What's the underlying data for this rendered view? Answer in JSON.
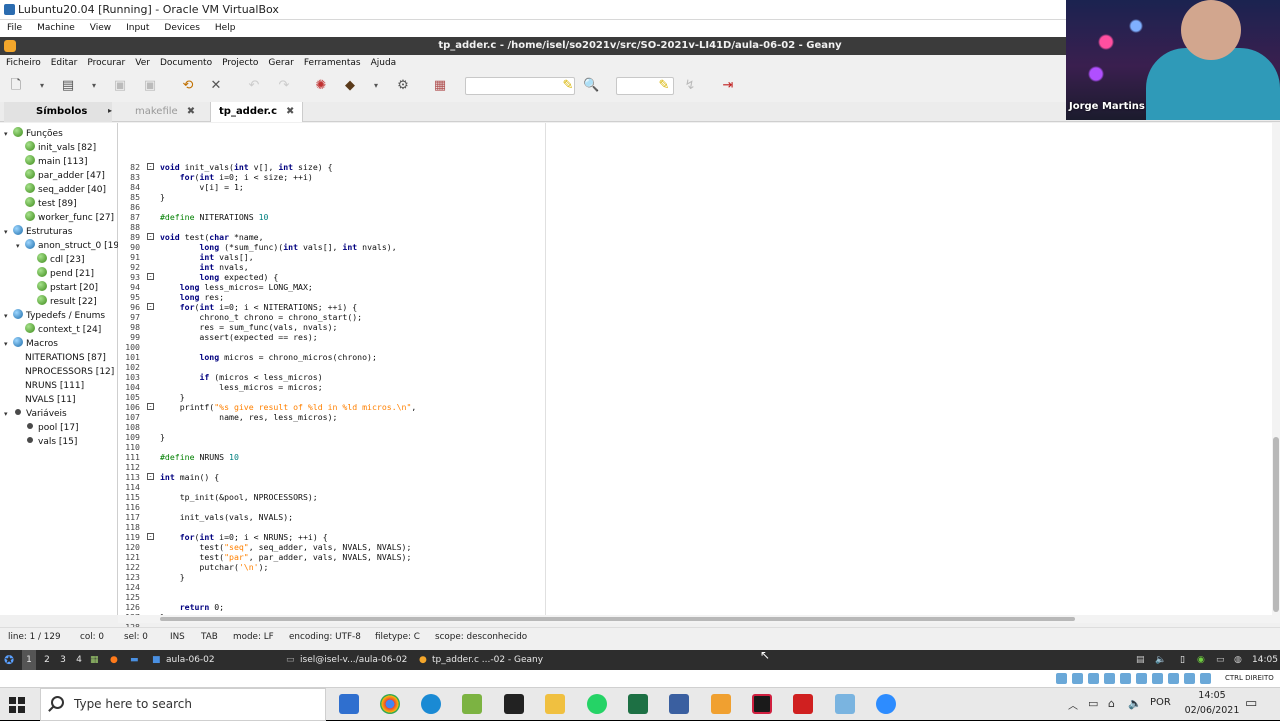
{
  "vbox": {
    "title": "Lubuntu20.04 [Running] - Oracle VM VirtualBox",
    "menu": [
      "File",
      "Machine",
      "View",
      "Input",
      "Devices",
      "Help"
    ]
  },
  "geany": {
    "title": "tp_adder.c - /home/isel/so2021v/src/SO-2021v-LI41D/aula-06-02 - Geany",
    "menu": [
      "Ficheiro",
      "Editar",
      "Procurar",
      "Ver",
      "Documento",
      "Projecto",
      "Gerar",
      "Ferramentas",
      "Ajuda"
    ],
    "sidebar_tab": "Símbolos",
    "tabs": [
      {
        "label": "makefile",
        "active": false
      },
      {
        "label": "tp_adder.c",
        "active": true
      }
    ],
    "symbols": [
      {
        "label": "Funções",
        "level": 0,
        "icon": "function",
        "expander": "open"
      },
      {
        "label": "init_vals [82]",
        "level": 1,
        "icon": "function"
      },
      {
        "label": "main [113]",
        "level": 1,
        "icon": "function"
      },
      {
        "label": "par_adder [47]",
        "level": 1,
        "icon": "function"
      },
      {
        "label": "seq_adder [40]",
        "level": 1,
        "icon": "function"
      },
      {
        "label": "test [89]",
        "level": 1,
        "icon": "function"
      },
      {
        "label": "worker_func [27]",
        "level": 1,
        "icon": "function"
      },
      {
        "label": "Estruturas",
        "level": 0,
        "icon": "struct",
        "expander": "open"
      },
      {
        "label": "anon_struct_0 [19]",
        "level": 1,
        "icon": "struct",
        "expander": "open"
      },
      {
        "label": "cdl [23]",
        "level": 2,
        "icon": "function"
      },
      {
        "label": "pend [21]",
        "level": 2,
        "icon": "function"
      },
      {
        "label": "pstart [20]",
        "level": 2,
        "icon": "function"
      },
      {
        "label": "result [22]",
        "level": 2,
        "icon": "function"
      },
      {
        "label": "Typedefs / Enums",
        "level": 0,
        "icon": "struct",
        "expander": "open"
      },
      {
        "label": "context_t [24]",
        "level": 1,
        "icon": "function"
      },
      {
        "label": "Macros",
        "level": 0,
        "icon": "struct",
        "expander": "open"
      },
      {
        "label": "NITERATIONS [87]",
        "level": 1,
        "icon": "macro"
      },
      {
        "label": "NPROCESSORS [12]",
        "level": 1,
        "icon": "macro"
      },
      {
        "label": "NRUNS [111]",
        "level": 1,
        "icon": "macro"
      },
      {
        "label": "NVALS [11]",
        "level": 1,
        "icon": "macro"
      },
      {
        "label": "Variáveis",
        "level": 0,
        "icon": "var",
        "expander": "open"
      },
      {
        "label": "pool [17]",
        "level": 1,
        "icon": "var"
      },
      {
        "label": "vals [15]",
        "level": 1,
        "icon": "var"
      }
    ],
    "line_numbers": [
      "82",
      "83",
      "84",
      "85",
      "86",
      "87",
      "88",
      "89",
      "90",
      "91",
      "92",
      "93",
      "94",
      "95",
      "96",
      "97",
      "98",
      "99",
      "100",
      "101",
      "102",
      "103",
      "104",
      "105",
      "106",
      "107",
      "108",
      "109",
      "110",
      "111",
      "112",
      "113",
      "114",
      "115",
      "116",
      "117",
      "118",
      "119",
      "120",
      "121",
      "122",
      "123",
      "124",
      "125",
      "126",
      "127",
      "128",
      "129"
    ],
    "code": [
      "void init_vals(int v[], int size) {",
      "    for(int i=0; i < size; ++i)",
      "        v[i] = 1;",
      "}",
      "",
      "#define NITERATIONS 10",
      "",
      "void test(char *name,",
      "        long (*sum_func)(int vals[], int nvals),",
      "        int vals[],",
      "        int nvals,",
      "        long expected) {",
      "    long less_micros= LONG_MAX;",
      "    long res;",
      "    for(int i=0; i < NITERATIONS; ++i) {",
      "        chrono_t chrono = chrono_start();",
      "        res = sum_func(vals, nvals);",
      "        assert(expected == res);",
      "",
      "        long micros = chrono_micros(chrono);",
      "",
      "        if (micros < less_micros)",
      "            less_micros = micros;",
      "    }",
      "    printf(\"%s give result of %ld in %ld micros.\\n\",",
      "            name, res, less_micros);",
      "",
      "}",
      "",
      "#define NRUNS 10",
      "",
      "int main() {",
      "",
      "    tp_init(&pool, NPROCESSORS);",
      "",
      "    init_vals(vals, NVALS);",
      "",
      "    for(int i=0; i < NRUNS; ++i) {",
      "        test(\"seq\", seq_adder, vals, NVALS, NVALS);",
      "        test(\"par\", par_adder, vals, NVALS, NVALS);",
      "        putchar('\\n');",
      "    }",
      "",
      "",
      "    return 0;",
      "}",
      "",
      ""
    ],
    "status": {
      "line": "line: 1 / 129",
      "col": "col: 0",
      "sel": "sel: 0",
      "ins": "INS",
      "tab": "TAB",
      "mode": "mode: LF",
      "encoding": "encoding: UTF-8",
      "filetype": "filetype: C",
      "scope": "scope: desconhecido"
    }
  },
  "lubuntu_taskbar": {
    "workspaces": [
      "1",
      "2",
      "3",
      "4"
    ],
    "folder": "aula-06-02",
    "terminal": "isel@isel-v.../aula-06-02",
    "geany": "tp_adder.c ...-02 - Geany",
    "clock": "14:05"
  },
  "vbox_status": {
    "host_key": "CTRL DIREITO"
  },
  "windows_taskbar": {
    "search_placeholder": "Type here to search",
    "language": "POR",
    "time": "14:05",
    "date": "02/06/2021"
  },
  "webcam": {
    "name": "Jorge Martins"
  },
  "colors": {
    "keyword": "#00007f",
    "string": "#ff8000",
    "preprocessor": "#007f00",
    "number": "#007f7f"
  }
}
